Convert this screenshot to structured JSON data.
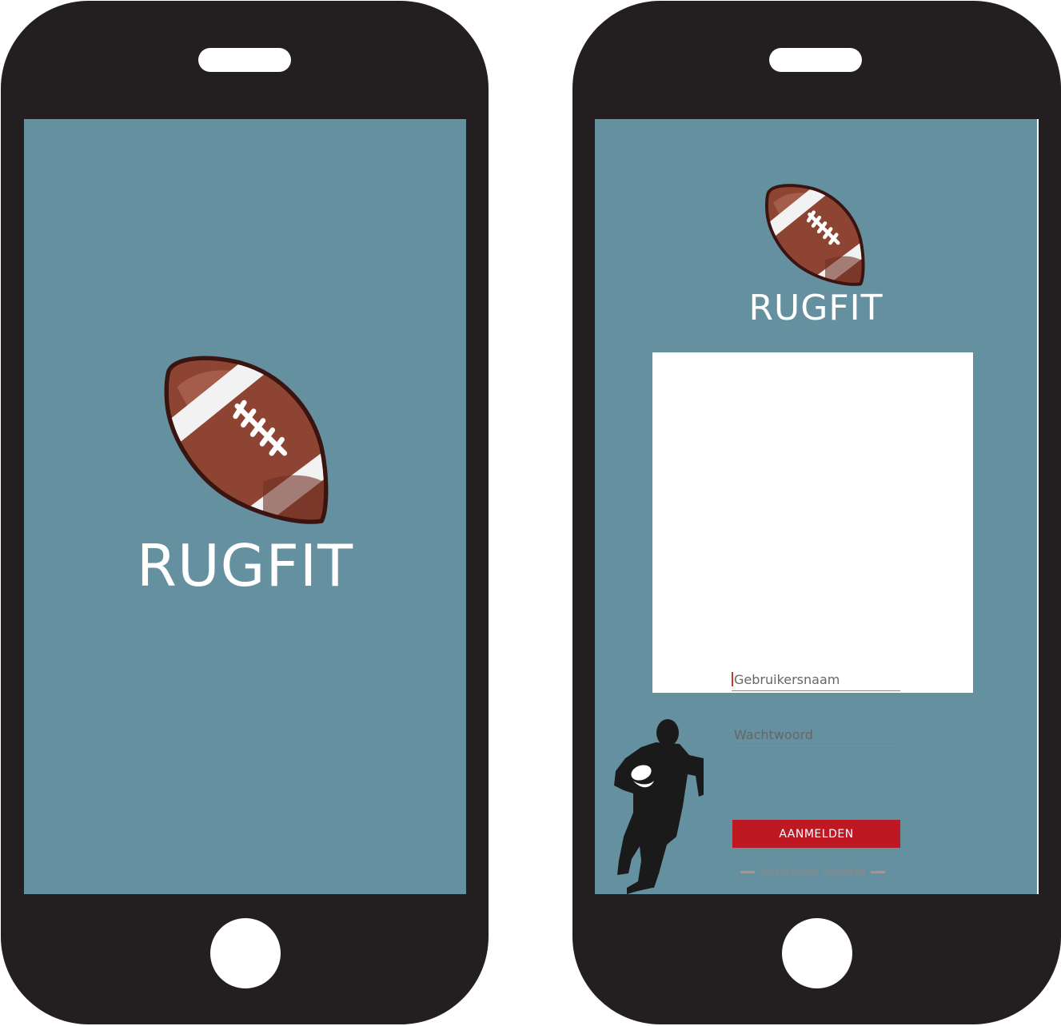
{
  "splash": {
    "title": "RUGFIT"
  },
  "login": {
    "title": "RUGFIT",
    "username_placeholder": "Gebruikersnaam",
    "password_placeholder": "Wachtwoord",
    "submit_label": "AANMELDEN",
    "forgot_label": "Wachtwoord Vergeten"
  },
  "colors": {
    "screen_background": "#6590a0",
    "phone_body": "#231f20",
    "button_red": "#be1823",
    "ball_brown": "#8e4433"
  },
  "icons": {
    "logo": "rugby-ball-icon",
    "decoration": "rugby-player-silhouette"
  }
}
